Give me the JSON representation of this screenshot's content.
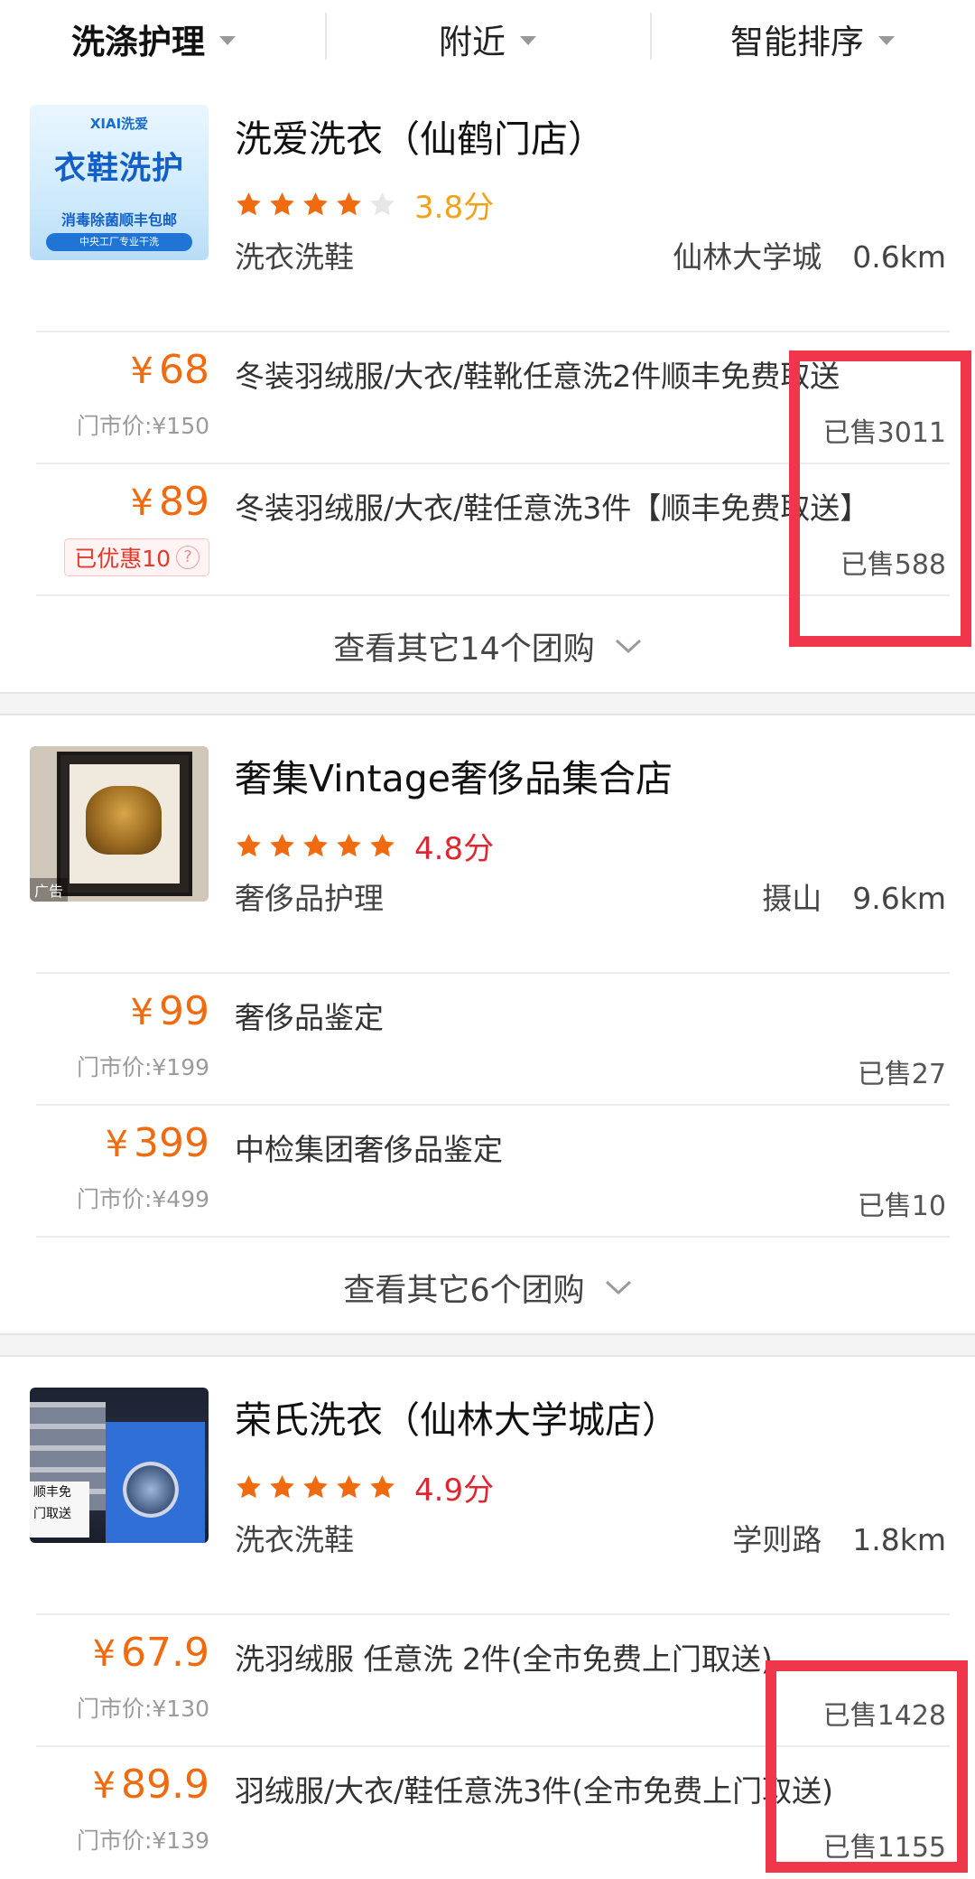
{
  "filter_bar": {
    "tabs": [
      {
        "label": "洗涤护理"
      },
      {
        "label": "附近"
      },
      {
        "label": "智能排序"
      }
    ]
  },
  "colors": {
    "price": "#f06b0f",
    "star_filled": "#f06b0f",
    "star_empty": "#e6e6e6",
    "score_mid": "#f0a21a",
    "score_high": "#e1252f",
    "highlight_box": "#f0364b"
  },
  "shops": [
    {
      "name": "洗爱洗衣（仙鹤门店）",
      "thumbnail": {
        "logo_text": "XIAI洗爱",
        "title": "衣鞋洗护",
        "subtitle": "消毒除菌顺丰包邮",
        "pill": "中央工厂专业干洗"
      },
      "rating": 3.8,
      "score_text": "3.8分",
      "category": "洗衣洗鞋",
      "area": "仙林大学城",
      "distance": "0.6km",
      "deals": [
        {
          "price": "68",
          "currency": "¥",
          "title": "冬装羽绒服/大衣/鞋靴任意洗2件顺丰免费取送",
          "original_price": "门市价:¥150",
          "sold": "已售3011"
        },
        {
          "price": "89",
          "currency": "¥",
          "title": "冬装羽绒服/大衣/鞋任意洗3件【顺丰免费取送】",
          "coupon": "已优惠10",
          "sold": "已售588"
        }
      ],
      "more_label": "查看其它14个团购"
    },
    {
      "name": "奢集Vintage奢侈品集合店",
      "thumbnail": {
        "ad_label": "广告"
      },
      "rating": 4.8,
      "score_text": "4.8分",
      "category": "奢侈品护理",
      "area": "摄山",
      "distance": "9.6km",
      "deals": [
        {
          "price": "99",
          "currency": "¥",
          "title": "奢侈品鉴定",
          "original_price": "门市价:¥199",
          "sold": "已售27"
        },
        {
          "price": "399",
          "currency": "¥",
          "title": "中检集团奢侈品鉴定",
          "original_price": "门市价:¥499",
          "sold": "已售10"
        }
      ],
      "more_label": "查看其它6个团购"
    },
    {
      "name": "荣氏洗衣（仙林大学城店）",
      "thumbnail": {
        "note_text_1": "顺丰免",
        "note_text_2": "门取送"
      },
      "rating": 4.9,
      "score_text": "4.9分",
      "category": "洗衣洗鞋",
      "area": "学则路",
      "distance": "1.8km",
      "deals": [
        {
          "price": "67.9",
          "currency": "¥",
          "title": "洗羽绒服 任意洗 2件(全市免费上门取送)",
          "original_price": "门市价:¥130",
          "sold": "已售1428"
        },
        {
          "price": "89.9",
          "currency": "¥",
          "title": "羽绒服/大衣/鞋任意洗3件(全市免费上门取送)",
          "original_price": "门市价:¥139",
          "sold": "已售1155"
        }
      ]
    }
  ]
}
